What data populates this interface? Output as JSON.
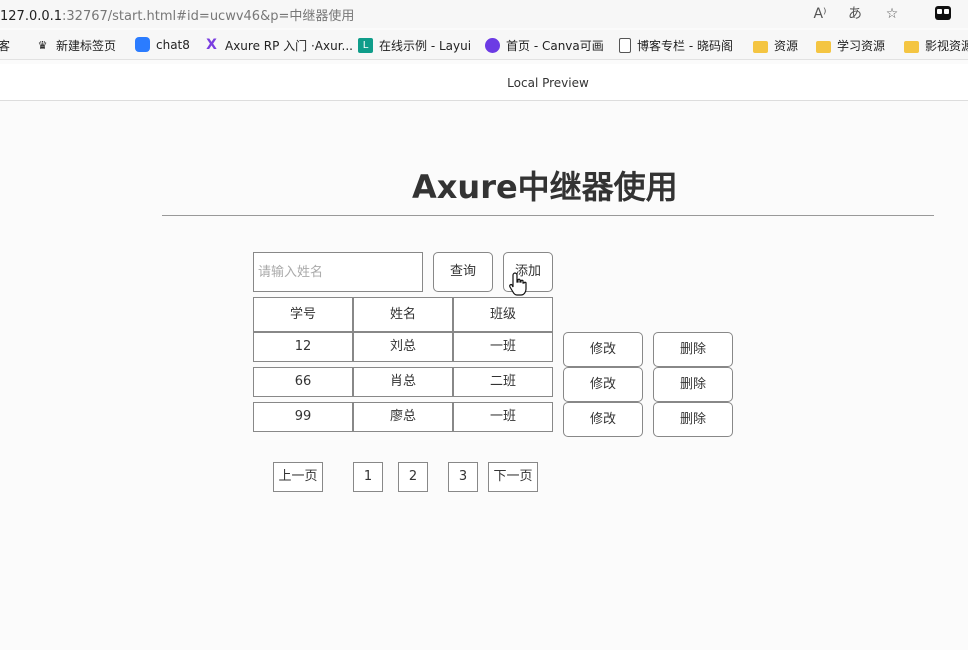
{
  "browser": {
    "url_host": "127.0.0.1",
    "url_rest": ":32767/start.html#id=ucwv46&p=中继器使用",
    "read_aloud_icon": "read-aloud-icon",
    "translate_icon": "translate-icon",
    "favorite_icon": "add-favorite-icon",
    "tabs_icon": "tab-actions-icon"
  },
  "bookmarks": [
    {
      "label": "博客",
      "icon": "folder-icon"
    },
    {
      "label": "新建标签页",
      "icon": "crown-icon"
    },
    {
      "label": "chat8",
      "icon": "chat-icon"
    },
    {
      "label": "Axure RP 入门 ·Axur...",
      "icon": "axure-icon"
    },
    {
      "label": "在线示例 - Layui",
      "icon": "layui-icon"
    },
    {
      "label": "首页 - Canva可画",
      "icon": "canva-icon"
    },
    {
      "label": "博客专栏 - 晓码阁",
      "icon": "page-icon"
    },
    {
      "label": "资源",
      "icon": "folder-icon"
    },
    {
      "label": "学习资源",
      "icon": "folder-icon"
    },
    {
      "label": "影视资源",
      "icon": "folder-icon"
    }
  ],
  "preview_title": "Local Preview",
  "page_title": "Axure中继器使用",
  "search": {
    "placeholder": "请输入姓名",
    "value": "",
    "query_label": "查询",
    "add_label": "添加"
  },
  "table": {
    "headers": [
      "学号",
      "姓名",
      "班级"
    ],
    "rows": [
      {
        "id": "12",
        "name": "刘总",
        "class": "一班"
      },
      {
        "id": "66",
        "name": "肖总",
        "class": "二班"
      },
      {
        "id": "99",
        "name": "廖总",
        "class": "一班"
      }
    ],
    "edit_label": "修改",
    "delete_label": "删除"
  },
  "pagination": {
    "prev_label": "上一页",
    "pages": [
      "1",
      "2",
      "3"
    ],
    "next_label": "下一页"
  }
}
